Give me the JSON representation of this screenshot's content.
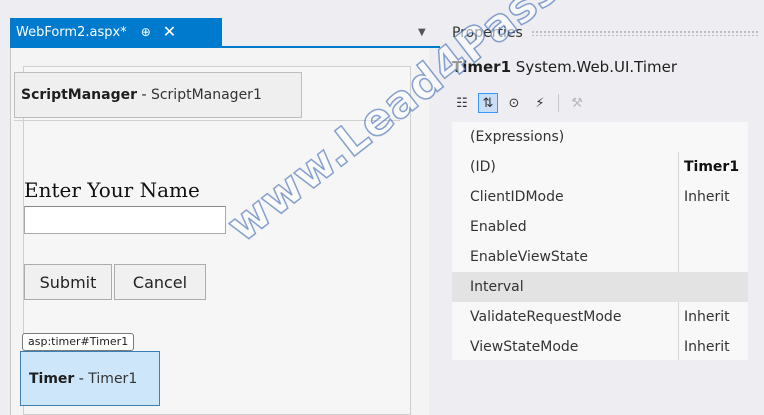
{
  "document": {
    "tab_title": "WebForm2.aspx*",
    "pin_glyph": "⊕",
    "close_glyph": "✕",
    "dropdown_glyph": "▼"
  },
  "designer": {
    "script_manager": {
      "type": "ScriptManager",
      "separator": " - ",
      "id": "ScriptManager1"
    },
    "name_label": "Enter Your Name",
    "name_input": {
      "value": "",
      "placeholder": ""
    },
    "submit_label": "Submit",
    "cancel_label": "Cancel",
    "timer_tag": "asp:timer#Timer1",
    "timer": {
      "type": "Timer",
      "separator": " - ",
      "id": "Timer1"
    }
  },
  "properties": {
    "title": "Properties",
    "object": {
      "id": "Timer1",
      "type": "System.Web.UI.Timer"
    },
    "toolbar": {
      "categorized_glyph": "☷",
      "alphabetical_glyph": "⇅",
      "properties_glyph": "⊙",
      "events_glyph": "⚡",
      "property_pages_glyph": "⚒"
    },
    "rows": [
      {
        "name": "(Expressions)",
        "value": ""
      },
      {
        "name": "(ID)",
        "value": "Timer1"
      },
      {
        "name": "ClientIDMode",
        "value": "Inherit"
      },
      {
        "name": "Enabled",
        "value": ""
      },
      {
        "name": "EnableViewState",
        "value": ""
      },
      {
        "name": "Interval",
        "value": ""
      },
      {
        "name": "ValidateRequestMode",
        "value": "Inherit"
      },
      {
        "name": "ViewStateMode",
        "value": "Inherit"
      }
    ],
    "selected_row": "Interval"
  },
  "watermark": "www.Lead4Pass.com",
  "colors": {
    "accent": "#007acc",
    "timer_fill": "#cde6fa",
    "timer_border": "#3c7fb1",
    "selected_row": "#e3e3e3"
  }
}
